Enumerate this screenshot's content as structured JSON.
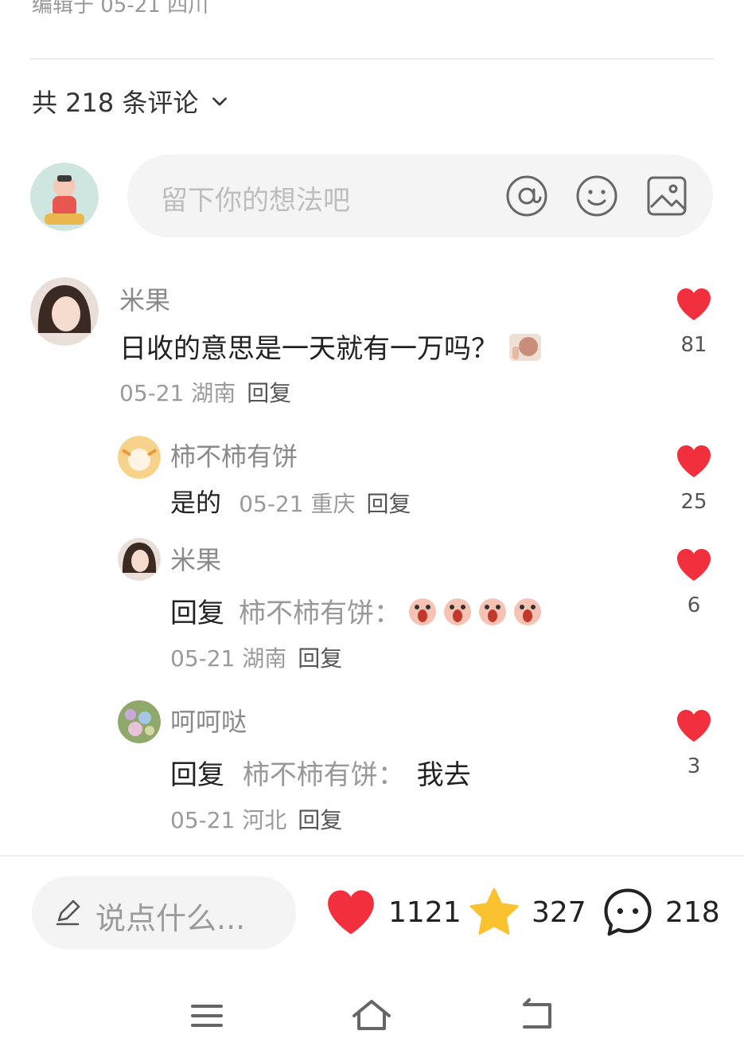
{
  "post": {
    "edited_meta": "编辑于 05-21 四川"
  },
  "comments_header": {
    "count_label": "共 218 条评论"
  },
  "composer": {
    "placeholder": "留下你的想法吧"
  },
  "comments": [
    {
      "user": "米果",
      "text": "日收的意思是一天就有一万吗？",
      "time_location": "05-21 湖南",
      "reply_label": "回复",
      "likes": "81"
    },
    {
      "user": "柿不柿有饼",
      "text": "是的",
      "time_location": "05-21 重庆",
      "reply_label": "回复",
      "likes": "25"
    },
    {
      "user": "米果",
      "reply_prefix": "回复",
      "reply_to": "柿不柿有饼：",
      "time_location": "05-21 湖南",
      "reply_label": "回复",
      "likes": "6"
    },
    {
      "user": "呵呵哒",
      "reply_prefix": "回复",
      "reply_to": "柿不柿有饼：",
      "text": "我去",
      "time_location": "05-21 河北",
      "reply_label": "回复",
      "likes": "3"
    }
  ],
  "bottom_bar": {
    "say_placeholder": "说点什么...",
    "likes": "1121",
    "favorites": "327",
    "comments": "218"
  },
  "colors": {
    "like_red": "#f2303d",
    "star_yellow": "#f9c22e"
  }
}
